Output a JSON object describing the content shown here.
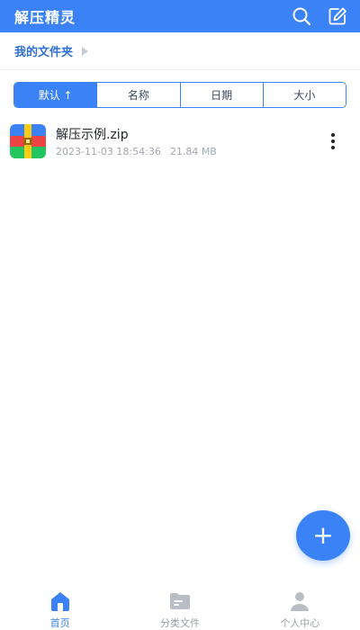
{
  "header": {
    "title": "解压精灵",
    "search_icon": "search-icon",
    "edit_icon": "edit-icon"
  },
  "breadcrumb": {
    "label": "我的文件夹"
  },
  "sort": {
    "tabs": [
      {
        "label": "默认 ↑",
        "active": true
      },
      {
        "label": "名称",
        "active": false
      },
      {
        "label": "日期",
        "active": false
      },
      {
        "label": "大小",
        "active": false
      }
    ]
  },
  "files": [
    {
      "name": "解压示例.zip",
      "date": "2023-11-03 18:54:36",
      "size": "21.84 MB",
      "icon": "zip-archive-icon"
    }
  ],
  "fab": {
    "label": "+"
  },
  "bottom_nav": {
    "items": [
      {
        "label": "首页",
        "icon": "home-icon",
        "active": true
      },
      {
        "label": "分类文件",
        "icon": "folder-icon",
        "active": false
      },
      {
        "label": "个人中心",
        "icon": "user-icon",
        "active": false
      }
    ]
  },
  "colors": {
    "accent": "#3B82F6",
    "muted": "#9aa0a8"
  }
}
